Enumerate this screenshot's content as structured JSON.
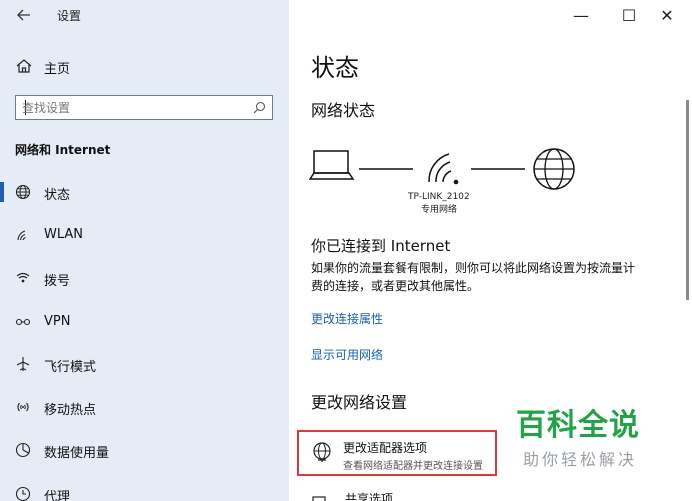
{
  "window": {
    "title": "设置",
    "back_icon": "back-arrow-icon",
    "controls": {
      "minimize": "—",
      "maximize": "☐",
      "close": "✕"
    }
  },
  "sidebar": {
    "home_label": "主页",
    "search_placeholder": "查找设置",
    "section_title": "网络和 Internet",
    "items": [
      {
        "label": "状态",
        "icon": "globe-icon",
        "active": true
      },
      {
        "label": "WLAN",
        "icon": "wifi-icon",
        "active": false
      },
      {
        "label": "拨号",
        "icon": "dialup-icon",
        "active": false
      },
      {
        "label": "VPN",
        "icon": "vpn-icon",
        "active": false
      },
      {
        "label": "飞行模式",
        "icon": "airplane-icon",
        "active": false
      },
      {
        "label": "移动热点",
        "icon": "hotspot-icon",
        "active": false
      },
      {
        "label": "数据使用量",
        "icon": "data-usage-icon",
        "active": false
      },
      {
        "label": "代理",
        "icon": "proxy-icon",
        "active": false
      }
    ]
  },
  "main": {
    "title": "状态",
    "network_status_heading": "网络状态",
    "diagram": {
      "ssid": "TP-LINK_2102",
      "network_type": "专用网络"
    },
    "connected_heading": "你已连接到 Internet",
    "description_line1": "如果你的流量套餐有限制，则你可以将此网络设置为按流量计",
    "description_line2": "费的连接，或者更改其他属性。",
    "link_change_properties": "更改连接属性",
    "link_show_networks": "显示可用网络",
    "change_settings_heading": "更改网络设置",
    "adapter_title": "更改适配器选项",
    "adapter_subtitle": "查看网络适配器并更改连接设置",
    "next_item_label": "共享选项"
  },
  "watermark": {
    "main": "百科全说",
    "sub": "助你轻松解决"
  },
  "colors": {
    "sidebar_bg": "#e6ecf6",
    "accent": "#1a5fb4",
    "highlight_border": "#d93a3a",
    "watermark_green": "#23a348"
  }
}
